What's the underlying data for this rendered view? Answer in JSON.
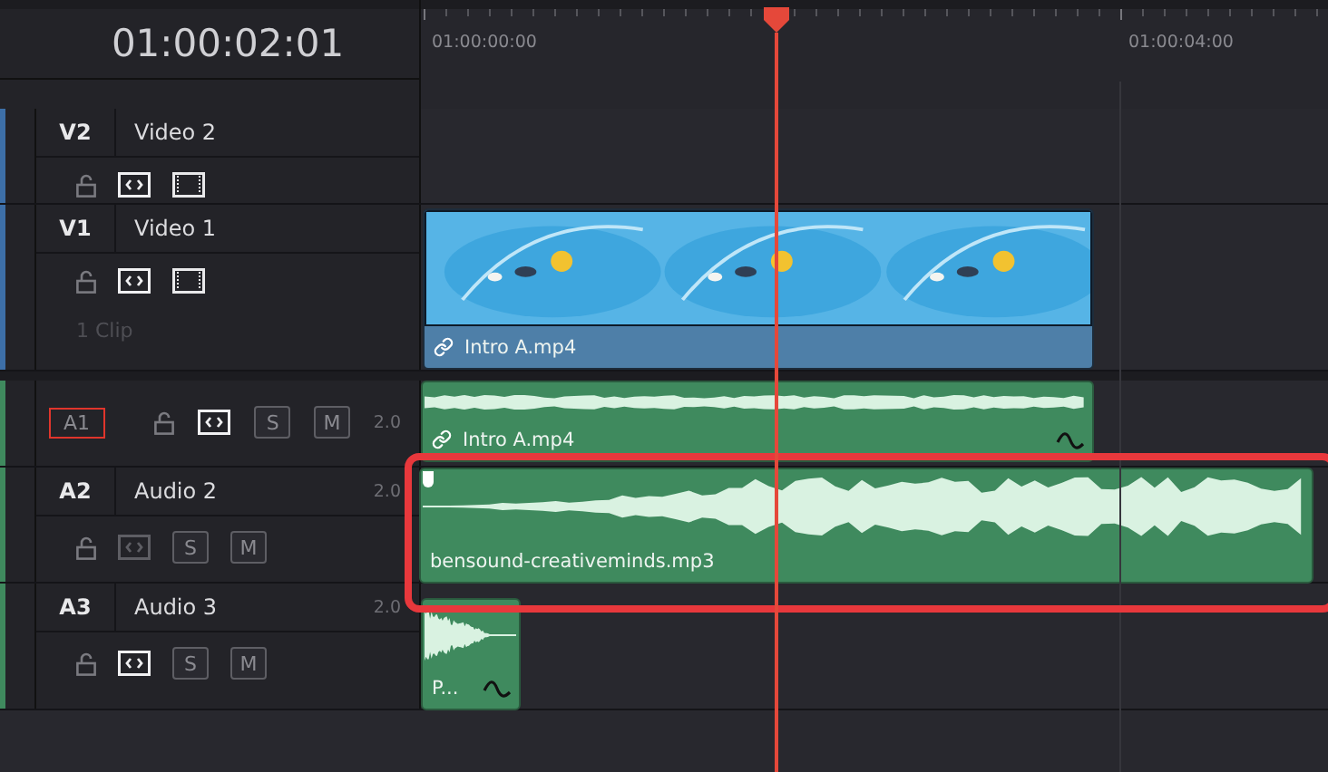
{
  "timecode": "01:00:02:01",
  "ruler_labels": [
    "01:00:00:00",
    "01:00:04:00"
  ],
  "tracks": [
    {
      "kind": "video",
      "badge": "V2",
      "name": "Video 2",
      "selected": false,
      "auto_select": true
    },
    {
      "kind": "video",
      "badge": "V1",
      "name": "Video 1",
      "selected": false,
      "auto_select": true,
      "clip_count": "1 Clip",
      "clips": [
        {
          "kind": "video",
          "name": "Intro A.mp4",
          "linked": true,
          "curve": false,
          "highlighted": false,
          "marker": false
        }
      ]
    },
    {
      "kind": "audio",
      "badge": "A1",
      "selected": true,
      "auto_select": true,
      "channels": "2.0",
      "solo_label": "S",
      "mute_label": "M",
      "clips": [
        {
          "kind": "audio",
          "name": "Intro A.mp4",
          "linked": true,
          "curve": true,
          "highlighted": false,
          "marker": false
        }
      ]
    },
    {
      "kind": "audio",
      "badge": "A2",
      "name": "Audio 2",
      "selected": false,
      "auto_select": false,
      "channels": "2.0",
      "solo_label": "S",
      "mute_label": "M",
      "clips": [
        {
          "kind": "audio",
          "name": "bensound-creativeminds.mp3",
          "linked": false,
          "curve": false,
          "highlighted": true,
          "marker": true
        }
      ]
    },
    {
      "kind": "audio",
      "badge": "A3",
      "name": "Audio 3",
      "selected": false,
      "auto_select": true,
      "channels": "2.0",
      "solo_label": "S",
      "mute_label": "M",
      "clips": [
        {
          "kind": "audio",
          "name": "P...",
          "linked": false,
          "curve": true,
          "highlighted": false,
          "marker": false
        }
      ]
    }
  ]
}
